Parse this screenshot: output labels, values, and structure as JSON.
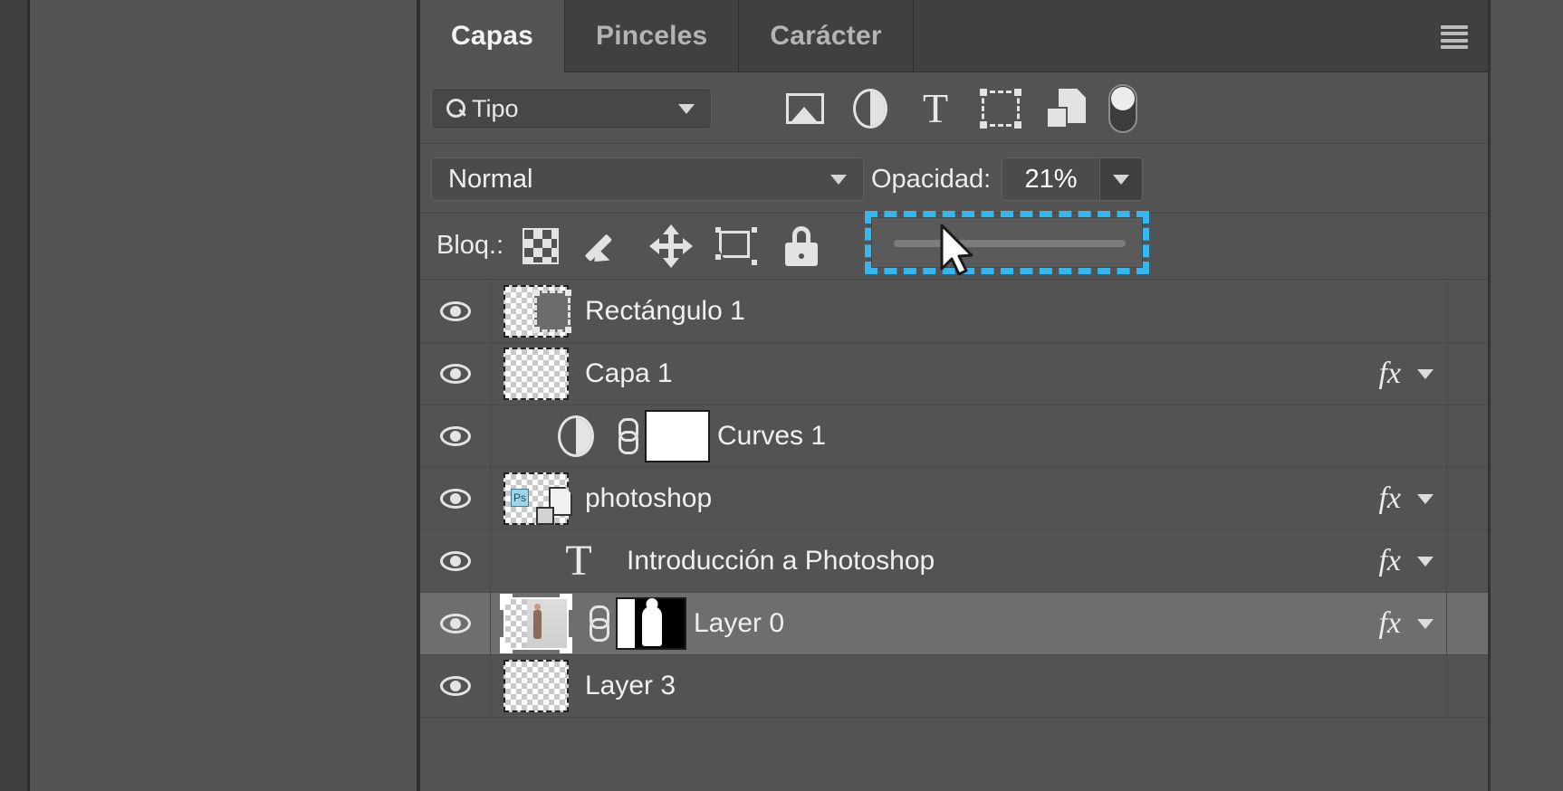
{
  "panel": {
    "tabs": [
      {
        "label": "Capas",
        "active": true
      },
      {
        "label": "Pinceles",
        "active": false
      },
      {
        "label": "Carácter",
        "active": false
      }
    ],
    "menu_icon": "hamburger-menu-icon"
  },
  "filter": {
    "select_value": "Tipo",
    "search_icon": "search-icon",
    "chevron_icon": "chevron-down-icon",
    "type_icons": [
      "pixel-layer-filter-icon",
      "adjustment-layer-filter-icon",
      "type-layer-filter-icon",
      "shape-layer-filter-icon",
      "smart-object-filter-icon"
    ],
    "toggle_icon": "filter-enable-toggle"
  },
  "blend": {
    "mode": "Normal",
    "opacity_label": "Opacidad:",
    "opacity_value": "21%",
    "chevron_icon": "chevron-down-icon"
  },
  "lock": {
    "label": "Bloq.:",
    "icons": [
      "lock-transparent-pixels-icon",
      "lock-image-pixels-icon",
      "lock-position-icon",
      "lock-artboard-nesting-icon",
      "lock-all-icon"
    ]
  },
  "opacity_slider": {
    "highlight_color": "#34b6ef",
    "cursor_icon": "mouse-pointer-cursor"
  },
  "layers": [
    {
      "name": "Rectángulo 1",
      "visible": true,
      "selected": false,
      "kind": "shape",
      "has_fx": false,
      "indent": false
    },
    {
      "name": "Capa 1",
      "visible": true,
      "selected": false,
      "kind": "pixel",
      "has_fx": true,
      "indent": false
    },
    {
      "name": "Curves 1",
      "visible": true,
      "selected": false,
      "kind": "adjustment",
      "has_fx": false,
      "indent": true
    },
    {
      "name": "photoshop",
      "visible": true,
      "selected": false,
      "kind": "smart",
      "has_fx": true,
      "indent": false
    },
    {
      "name": "Introducción a Photoshop",
      "visible": true,
      "selected": false,
      "kind": "type",
      "has_fx": true,
      "indent": true
    },
    {
      "name": "Layer 0",
      "visible": true,
      "selected": true,
      "kind": "masked-photo",
      "has_fx": true,
      "indent": false
    },
    {
      "name": "Layer 3",
      "visible": true,
      "selected": false,
      "kind": "pixel",
      "has_fx": false,
      "indent": false
    }
  ]
}
